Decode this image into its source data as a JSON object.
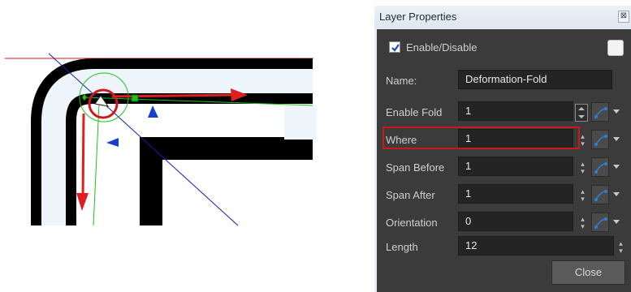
{
  "dialog": {
    "title": "Layer Properties",
    "close_glyph": "⊠",
    "enable_label": "Enable/Disable",
    "enable_checked": true,
    "fields": [
      {
        "label": "Name:",
        "value": "Deformation-Fold",
        "stepper": "none",
        "function_button": false
      },
      {
        "label": "Enable Fold",
        "value": "1",
        "stepper": "box",
        "function_button": true
      },
      {
        "label": "Where",
        "value": "1",
        "stepper": "arrows",
        "function_button": true
      },
      {
        "label": "Span Before",
        "value": "1",
        "stepper": "arrows",
        "function_button": true
      },
      {
        "label": "Span After",
        "value": "1",
        "stepper": "arrows",
        "function_button": true
      },
      {
        "label": "Orientation",
        "value": "0",
        "stepper": "arrows",
        "function_button": true
      },
      {
        "label": "Length",
        "value": "12",
        "stepper": "arrows",
        "function_button": false
      }
    ],
    "highlighted_field": "Where",
    "close_button": "Close"
  },
  "colors": {
    "panel_bg": "#3b3b3b",
    "highlight": "#c8181c",
    "accent_blue": "#2d7fd6",
    "deform_red": "#e02020",
    "deform_green": "#20c020",
    "guide_blue": "#1a1aa8"
  },
  "illustration": {
    "icons": [
      "fold-ring-icon",
      "arrow-right-icon",
      "arrow-down-icon",
      "triangle-marker-icon"
    ]
  }
}
